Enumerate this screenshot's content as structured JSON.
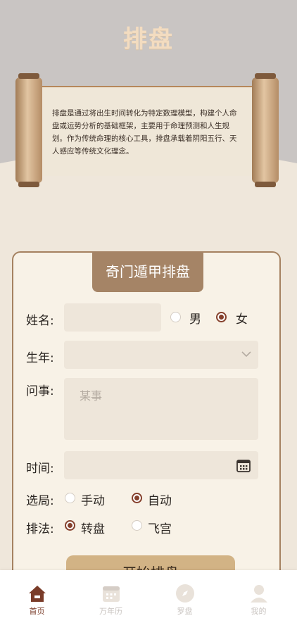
{
  "header": {
    "title": "排盘",
    "intro": "排盘是通过将出生时间转化为特定数理模型，构建个人命盘或运势分析的基础框架，主要用于命理预测和人生规划。作为传统命理的核心工具，排盘承载着阴阳五行、天人感应等传统文化理念。"
  },
  "form": {
    "title": "奇门遁甲排盘",
    "name_label": "姓名:",
    "name_value": "",
    "gender_options": [
      "男",
      "女"
    ],
    "gender_selected": "女",
    "year_label": "生年:",
    "year_value": "",
    "question_label": "问事:",
    "question_placeholder": "某事",
    "time_label": "时间:",
    "time_value": "",
    "mode_label": "选局:",
    "mode_options": [
      "手动",
      "自动"
    ],
    "mode_selected": "自动",
    "method_label": "排法:",
    "method_options": [
      "转盘",
      "飞宫"
    ],
    "method_selected": "转盘",
    "submit_label": "开始排盘"
  },
  "tabbar": {
    "items": [
      {
        "label": "首页",
        "icon": "home-icon",
        "active": true
      },
      {
        "label": "万年历",
        "icon": "calendar-icon",
        "active": false
      },
      {
        "label": "罗盘",
        "icon": "compass-icon",
        "active": false
      },
      {
        "label": "我的",
        "icon": "user-icon",
        "active": false
      }
    ]
  },
  "colors": {
    "accent": "#85402c",
    "card_title_bg": "#a58466",
    "button_bg": "#d2b385",
    "page_bg": "#efe7db"
  }
}
